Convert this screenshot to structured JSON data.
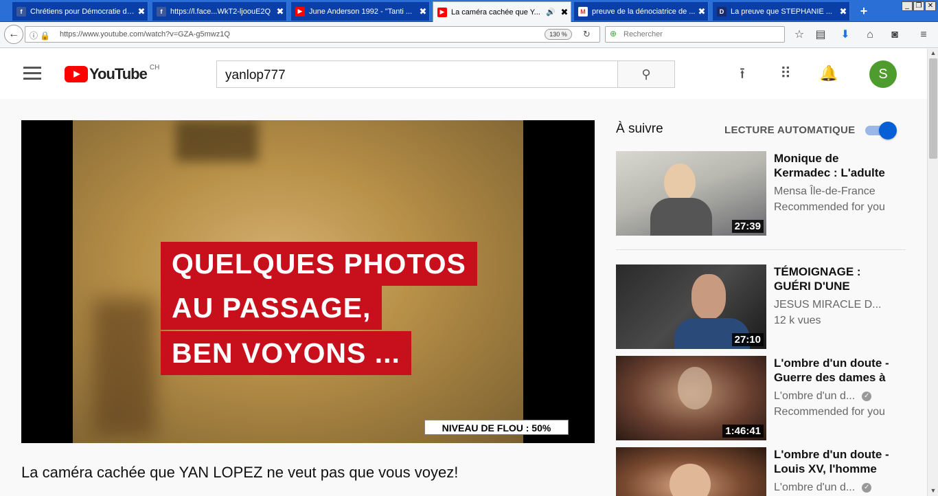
{
  "browser": {
    "tabs": [
      {
        "label": "Chrétiens pour Démocratie dir...",
        "favicon": "facebook-icon",
        "fav_text": "f",
        "kind": "fb"
      },
      {
        "label": "https://l.face...WkT2-ljoouE2Q",
        "favicon": "facebook-icon",
        "fav_text": "f",
        "kind": "fb"
      },
      {
        "label": "June Anderson 1992 - \"Tanti ...",
        "favicon": "youtube-icon",
        "fav_text": "▶",
        "kind": "yt"
      },
      {
        "label": "La caméra cachée que Y...",
        "favicon": "youtube-icon",
        "fav_text": "▶",
        "kind": "yt",
        "active": true
      },
      {
        "label": "preuve de la dénociatrice de ...",
        "favicon": "gmail-icon",
        "fav_text": "M",
        "kind": "gm"
      },
      {
        "label": "La preuve que STEPHANIE ...",
        "favicon": "dailymotion-icon",
        "fav_text": "D",
        "kind": "dl"
      }
    ],
    "tab_close": "✖",
    "new_tab": "+",
    "url": "https://www.youtube.com/watch?v=GZA-g5mwz1Q",
    "zoom": "130 %",
    "search_placeholder": "Rechercher"
  },
  "youtube": {
    "logo_text": "YouTube",
    "country": "CH",
    "search_value": "yanlop777",
    "avatar_letter": "S"
  },
  "video": {
    "caption_lines": [
      "QUELQUES PHOTOS",
      "AU PASSAGE,",
      "BEN VOYONS ..."
    ],
    "blur_label": "NIVEAU DE FLOU : 50%",
    "title": "La caméra cachée que YAN LOPEZ ne veut pas que vous voyez!"
  },
  "sidebar": {
    "up_next": "À suivre",
    "autoplay_label": "LECTURE AUTOMATIQUE",
    "autoplay_on": true,
    "accent": "#065fd4",
    "items": [
      {
        "title": "Monique de Kermadec : L'adulte",
        "channel": "Mensa Île-de-France",
        "meta": "Recommended for you",
        "duration": "27:39",
        "verified": false
      },
      {
        "title": "TÉMOIGNAGE : GUÉRI D'UNE",
        "channel": "JESUS MIRACLE D...",
        "meta": "12 k vues",
        "duration": "27:10",
        "verified": false
      },
      {
        "title": "L'ombre d'un doute - Guerre des dames à",
        "channel": "L'ombre d'un d...",
        "meta": "Recommended for you",
        "duration": "1:46:41",
        "verified": true
      },
      {
        "title": "L'ombre d'un doute - Louis XV, l'homme",
        "channel": "L'ombre d'un d...",
        "meta": "",
        "duration": "",
        "verified": true
      }
    ]
  }
}
